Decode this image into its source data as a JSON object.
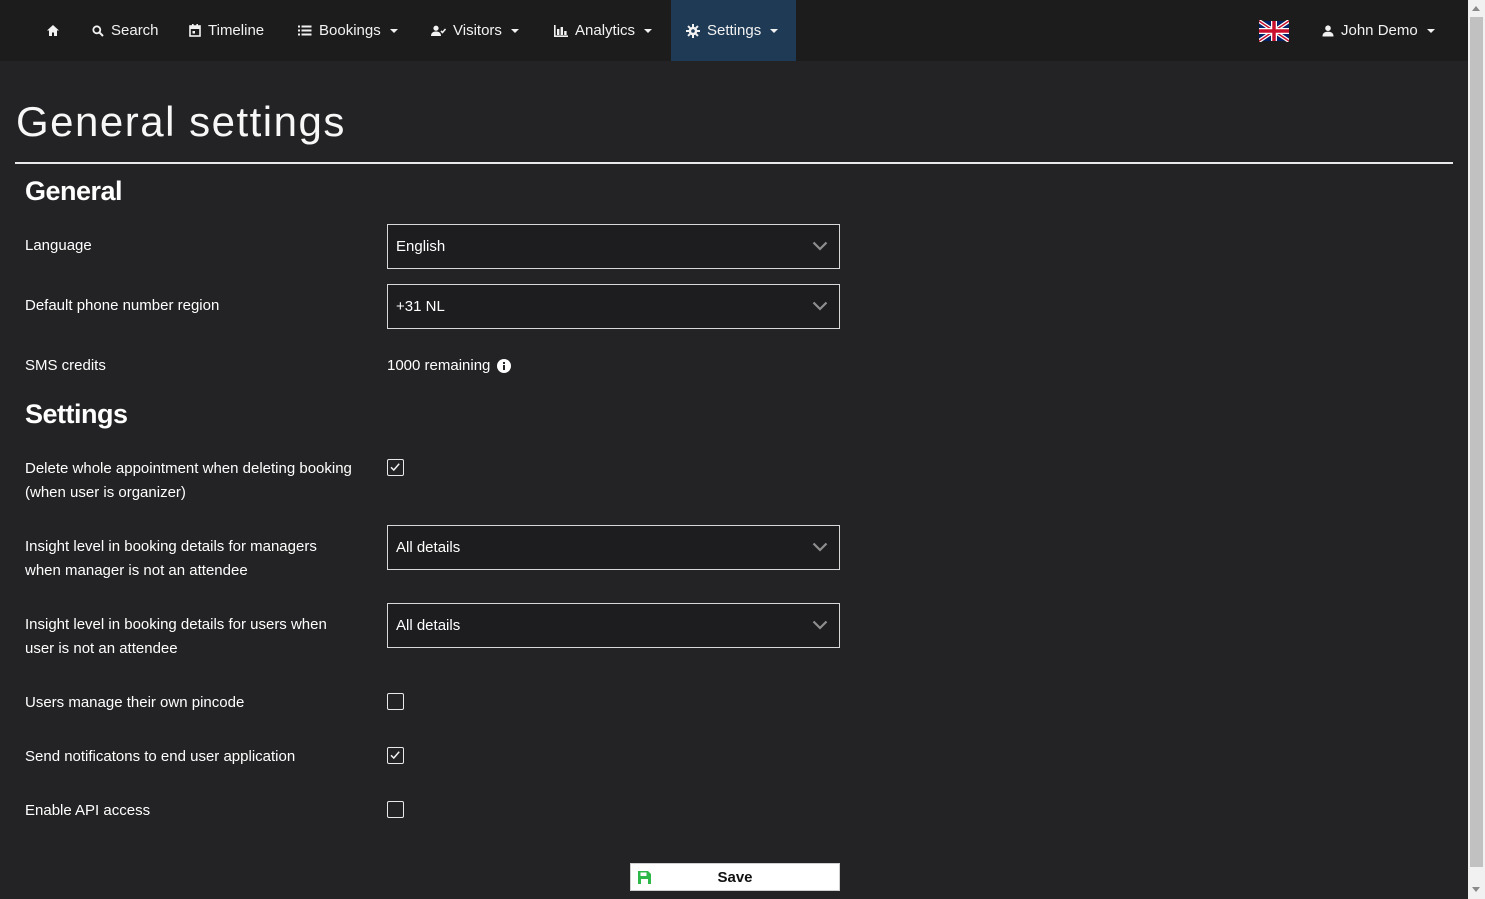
{
  "nav": {
    "items": [
      {
        "label": "",
        "icon": "home-icon"
      },
      {
        "label": "Search",
        "icon": "search-icon"
      },
      {
        "label": "Timeline",
        "icon": "calendar-icon"
      },
      {
        "label": "Bookings",
        "icon": "list-icon",
        "dropdown": true
      },
      {
        "label": "Visitors",
        "icon": "visitor-icon",
        "dropdown": true
      },
      {
        "label": "Analytics",
        "icon": "bar-chart-icon",
        "dropdown": true
      },
      {
        "label": "Settings",
        "icon": "gear-icon",
        "dropdown": true,
        "active": true
      }
    ],
    "language_flag": "uk-flag-icon",
    "user": {
      "label": "John Demo",
      "icon": "user-icon"
    }
  },
  "page": {
    "title": "General settings"
  },
  "general": {
    "heading": "General",
    "language": {
      "label": "Language",
      "value": "English"
    },
    "phone_region": {
      "label": "Default phone number region",
      "value": "+31 NL"
    },
    "sms_credits": {
      "label": "SMS credits",
      "value": "1000 remaining"
    }
  },
  "settings": {
    "heading": "Settings",
    "delete_appointment": {
      "label": "Delete whole appointment when deleting booking (when user is organizer)",
      "checked": true
    },
    "insight_managers": {
      "label": "Insight level in booking details for managers when manager is not an attendee",
      "value": "All details"
    },
    "insight_users": {
      "label": "Insight level in booking details for users when user is not an attendee",
      "value": "All details"
    },
    "own_pincode": {
      "label": "Users manage their own pincode",
      "checked": false
    },
    "notifications": {
      "label": "Send notificatons to end user application",
      "checked": true
    },
    "api_access": {
      "label": "Enable API access",
      "checked": false
    }
  },
  "actions": {
    "save_label": "Save"
  },
  "colors": {
    "background": "#232224",
    "navbar": "#1c1c1d",
    "nav_active": "#1f3a55",
    "save_icon": "#2fb84a"
  }
}
